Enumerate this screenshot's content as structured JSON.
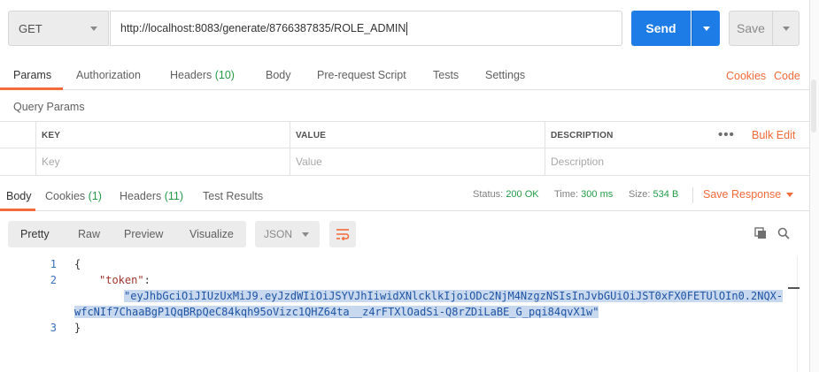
{
  "request": {
    "method": "GET",
    "url": "http://localhost:8083/generate/8766387835/ROLE_ADMIN",
    "send_label": "Send",
    "save_label": "Save"
  },
  "request_tabs": [
    {
      "label": "Params",
      "count": ""
    },
    {
      "label": "Authorization",
      "count": ""
    },
    {
      "label": "Headers",
      "count": "(10)"
    },
    {
      "label": "Body",
      "count": ""
    },
    {
      "label": "Pre-request Script",
      "count": ""
    },
    {
      "label": "Tests",
      "count": ""
    },
    {
      "label": "Settings",
      "count": ""
    }
  ],
  "request_links": {
    "cookies": "Cookies",
    "code": "Code"
  },
  "query_params": {
    "title": "Query Params",
    "headers": {
      "key": "KEY",
      "value": "VALUE",
      "description": "DESCRIPTION"
    },
    "placeholders": {
      "key": "Key",
      "value": "Value",
      "description": "Description"
    },
    "more": "•••",
    "bulk_edit": "Bulk Edit"
  },
  "response_tabs": [
    {
      "label": "Body",
      "count": ""
    },
    {
      "label": "Cookies",
      "count": "(1)"
    },
    {
      "label": "Headers",
      "count": "(11)"
    },
    {
      "label": "Test Results",
      "count": ""
    }
  ],
  "response_meta": {
    "status_label": "Status:",
    "status_value": "200 OK",
    "time_label": "Time:",
    "time_value": "300 ms",
    "size_label": "Size:",
    "size_value": "534 B",
    "save_response": "Save Response"
  },
  "view_tabs": [
    "Pretty",
    "Raw",
    "Preview",
    "Visualize"
  ],
  "format": "JSON",
  "code": {
    "line_numbers": [
      "1",
      "2",
      "3"
    ],
    "open_brace": "{",
    "key": "\"token\"",
    "colon": ":",
    "value_line1": "\"eyJhbGciOiJIUzUxMiJ9.eyJzdWIiOiJSYVJhIiwidXNlcklkIjoiODc2NjM4NzgzNSIsInJvbGUiOiJST0xFX0FETUlOIn0.2NQX-",
    "value_line2": "wfcNIf7ChaaBgP1QqBRpQeC84kqh95oVizc1QHZ64ta__z4rFTXlOadSi-Q8rZDiLaBE_G_pqi84qvX1w\"",
    "close_brace": "}"
  },
  "colors": {
    "accent": "#f26b3a",
    "send": "#1d7ce6",
    "ok": "#249c47"
  }
}
